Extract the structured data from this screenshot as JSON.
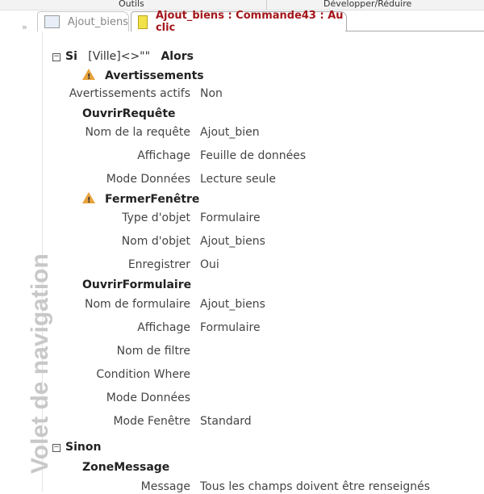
{
  "ribbon": {
    "tools": "Outils",
    "expand": "Développer/Réduire"
  },
  "nav": {
    "title": "Volet de navigation",
    "chevron": "»"
  },
  "tabs": [
    {
      "label": "Ajout_biens",
      "icon": "form-icon"
    },
    {
      "label": "Ajout_biens : Commande43 : Au clic",
      "icon": "macro-icon"
    }
  ],
  "macro": {
    "if_kw": "Si",
    "condition": "[Ville]<>\"\"",
    "then_kw": "Alors",
    "warnings": {
      "name": "Avertissements",
      "args": [
        {
          "label": "Avertissements actifs",
          "value": "Non"
        }
      ]
    },
    "openquery": {
      "name": "OuvrirRequête",
      "args": [
        {
          "label": "Nom de la requête",
          "value": "Ajout_bien"
        },
        {
          "label": "Affichage",
          "value": "Feuille de données"
        },
        {
          "label": "Mode Données",
          "value": "Lecture seule"
        }
      ]
    },
    "closewindow": {
      "name": "FermerFenêtre",
      "args": [
        {
          "label": "Type d'objet",
          "value": "Formulaire"
        },
        {
          "label": "Nom d'objet",
          "value": "Ajout_biens"
        },
        {
          "label": "Enregistrer",
          "value": "Oui"
        }
      ]
    },
    "openform": {
      "name": "OuvrirFormulaire",
      "args": [
        {
          "label": "Nom de formulaire",
          "value": "Ajout_biens"
        },
        {
          "label": "Affichage",
          "value": "Formulaire"
        },
        {
          "label": "Nom de filtre",
          "value": ""
        },
        {
          "label": "Condition Where",
          "value": ""
        },
        {
          "label": "Mode Données",
          "value": ""
        },
        {
          "label": "Mode Fenêtre",
          "value": "Standard"
        }
      ]
    },
    "else_kw": "Sinon",
    "msgbox": {
      "name": "ZoneMessage",
      "args": [
        {
          "label": "Message",
          "value": "Tous les champs doivent être renseignés"
        }
      ]
    }
  }
}
